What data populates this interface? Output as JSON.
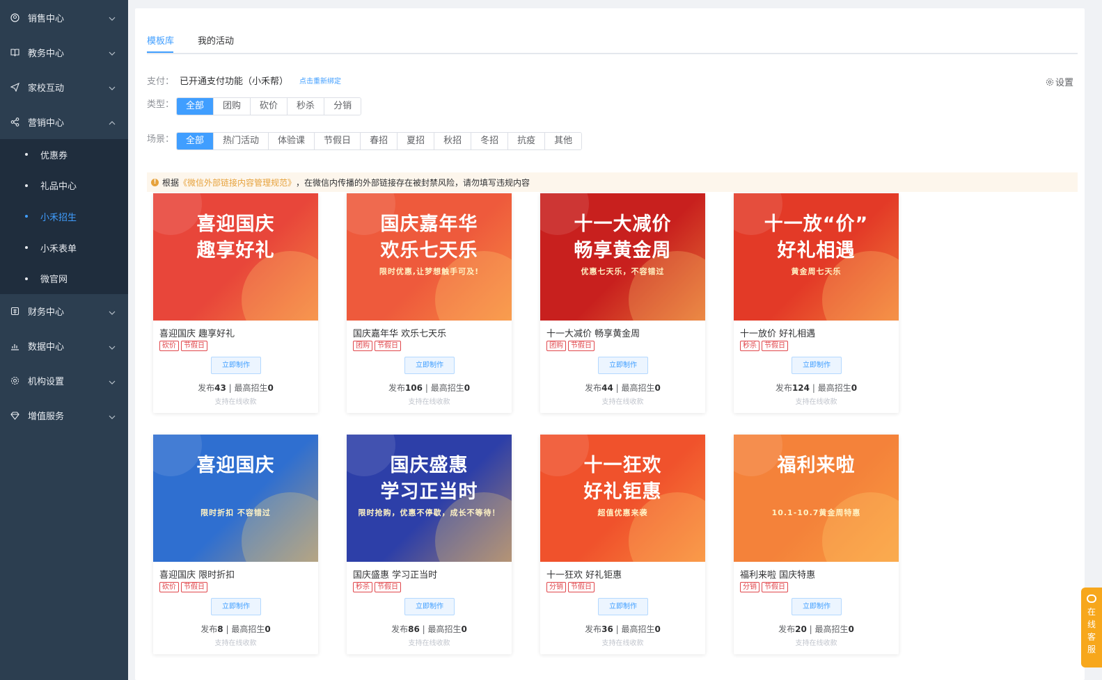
{
  "sidebar": {
    "items": [
      {
        "label": "销售中心",
        "icon": "sales-icon",
        "expanded": false
      },
      {
        "label": "教务中心",
        "icon": "book-icon",
        "expanded": false
      },
      {
        "label": "家校互动",
        "icon": "send-icon",
        "expanded": false
      },
      {
        "label": "营销中心",
        "icon": "share-icon",
        "expanded": true
      },
      {
        "label": "财务中心",
        "icon": "finance-icon",
        "expanded": false
      },
      {
        "label": "数据中心",
        "icon": "chart-icon",
        "expanded": false
      },
      {
        "label": "机构设置",
        "icon": "gear-icon",
        "expanded": false
      },
      {
        "label": "增值服务",
        "icon": "diamond-icon",
        "expanded": false
      }
    ],
    "submenu": [
      {
        "label": "优惠券",
        "active": false
      },
      {
        "label": "礼品中心",
        "active": false
      },
      {
        "label": "小禾招生",
        "active": true
      },
      {
        "label": "小禾表单",
        "active": false
      },
      {
        "label": "微官网",
        "active": false
      }
    ]
  },
  "tabs": [
    {
      "label": "模板库",
      "active": true
    },
    {
      "label": "我的活动",
      "active": false
    }
  ],
  "payment": {
    "label": "支付：",
    "status": "已开通支付功能（小禾帮）",
    "rebind_link": "点击重新绑定"
  },
  "settings_label": "设置",
  "type_filter": {
    "label": "类型：",
    "options": [
      "全部",
      "团购",
      "砍价",
      "秒杀",
      "分销"
    ],
    "selected": "全部"
  },
  "scene_filter": {
    "label": "场景：",
    "options": [
      "全部",
      "热门活动",
      "体验课",
      "节假日",
      "春招",
      "夏招",
      "秋招",
      "冬招",
      "抗疫",
      "其他"
    ],
    "selected": "全部"
  },
  "notice": {
    "prefix": "根据",
    "link": "《微信外部链接内容管理规范》",
    "suffix": "，在微信内传播的外部链接存在被封禁风险，请勿填写违规内容"
  },
  "cards": [
    {
      "poster_title_1": "喜迎国庆",
      "poster_title_2": "趣享好礼",
      "poster_sub": "",
      "title": "喜迎国庆 趣享好礼",
      "tags": [
        "砍价",
        "节假日"
      ],
      "button": "立即制作",
      "published_label": "发布",
      "published": "43",
      "sep": " | ",
      "max_label": "最高招生",
      "max": "0",
      "online": "支持在线收款",
      "bg": "#e8463a"
    },
    {
      "poster_title_1": "国庆嘉年华",
      "poster_title_2": "欢乐七天乐",
      "poster_sub": "限时优惠,让梦想触手可及!",
      "title": "国庆嘉年华 欢乐七天乐",
      "tags": [
        "团购",
        "节假日"
      ],
      "button": "立即制作",
      "published_label": "发布",
      "published": "106",
      "sep": " | ",
      "max_label": "最高招生",
      "max": "0",
      "online": "支持在线收款",
      "bg": "#ee5a3c"
    },
    {
      "poster_title_1": "十一大减价",
      "poster_title_2": "畅享黄金周",
      "poster_sub": "优惠七天乐，不容错过",
      "title": "十一大减价 畅享黄金周",
      "tags": [
        "团购",
        "节假日"
      ],
      "button": "立即制作",
      "published_label": "发布",
      "published": "44",
      "sep": " | ",
      "max_label": "最高招生",
      "max": "0",
      "online": "支持在线收款",
      "bg": "#c8201e"
    },
    {
      "poster_title_1": "十一放“价”",
      "poster_title_2": "好礼相遇",
      "poster_sub": "黄金周七天乐",
      "title": "十一放价 好礼相遇",
      "tags": [
        "秒杀",
        "节假日"
      ],
      "button": "立即制作",
      "published_label": "发布",
      "published": "124",
      "sep": " | ",
      "max_label": "最高招生",
      "max": "0",
      "online": "支持在线收款",
      "bg": "#e33a27"
    },
    {
      "poster_title_1": "喜迎国庆",
      "poster_title_2": "",
      "poster_sub": "限时折扣 不容错过",
      "title": "喜迎国庆 限时折扣",
      "tags": [
        "砍价",
        "节假日"
      ],
      "button": "立即制作",
      "published_label": "发布",
      "published": "8",
      "sep": " | ",
      "max_label": "最高招生",
      "max": "0",
      "online": "支持在线收款",
      "bg": "#2f6fd0"
    },
    {
      "poster_title_1": "国庆盛惠",
      "poster_title_2": "学习正当时",
      "poster_sub": "限时抢购，优惠不停歇，成长不等待！",
      "title": "国庆盛惠 学习正当时",
      "tags": [
        "秒杀",
        "节假日"
      ],
      "button": "立即制作",
      "published_label": "发布",
      "published": "86",
      "sep": " | ",
      "max_label": "最高招生",
      "max": "0",
      "online": "支持在线收款",
      "bg": "#2d3fa8"
    },
    {
      "poster_title_1": "十一狂欢",
      "poster_title_2": "好礼钜惠",
      "poster_sub": "超值优惠来袭",
      "title": "十一狂欢 好礼钜惠",
      "tags": [
        "分销",
        "节假日"
      ],
      "button": "立即制作",
      "published_label": "发布",
      "published": "36",
      "sep": " | ",
      "max_label": "最高招生",
      "max": "0",
      "online": "支持在线收款",
      "bg": "#f0522c"
    },
    {
      "poster_title_1": "福利来啦",
      "poster_title_2": "",
      "poster_sub": "10.1-10.7黄金周特惠",
      "title": "福利来啦 国庆特惠",
      "tags": [
        "分销",
        "节假日"
      ],
      "button": "立即制作",
      "published_label": "发布",
      "published": "20",
      "sep": " | ",
      "max_label": "最高招生",
      "max": "0",
      "online": "支持在线收款",
      "bg": "#f4823a"
    }
  ],
  "float_help": "在线客服"
}
